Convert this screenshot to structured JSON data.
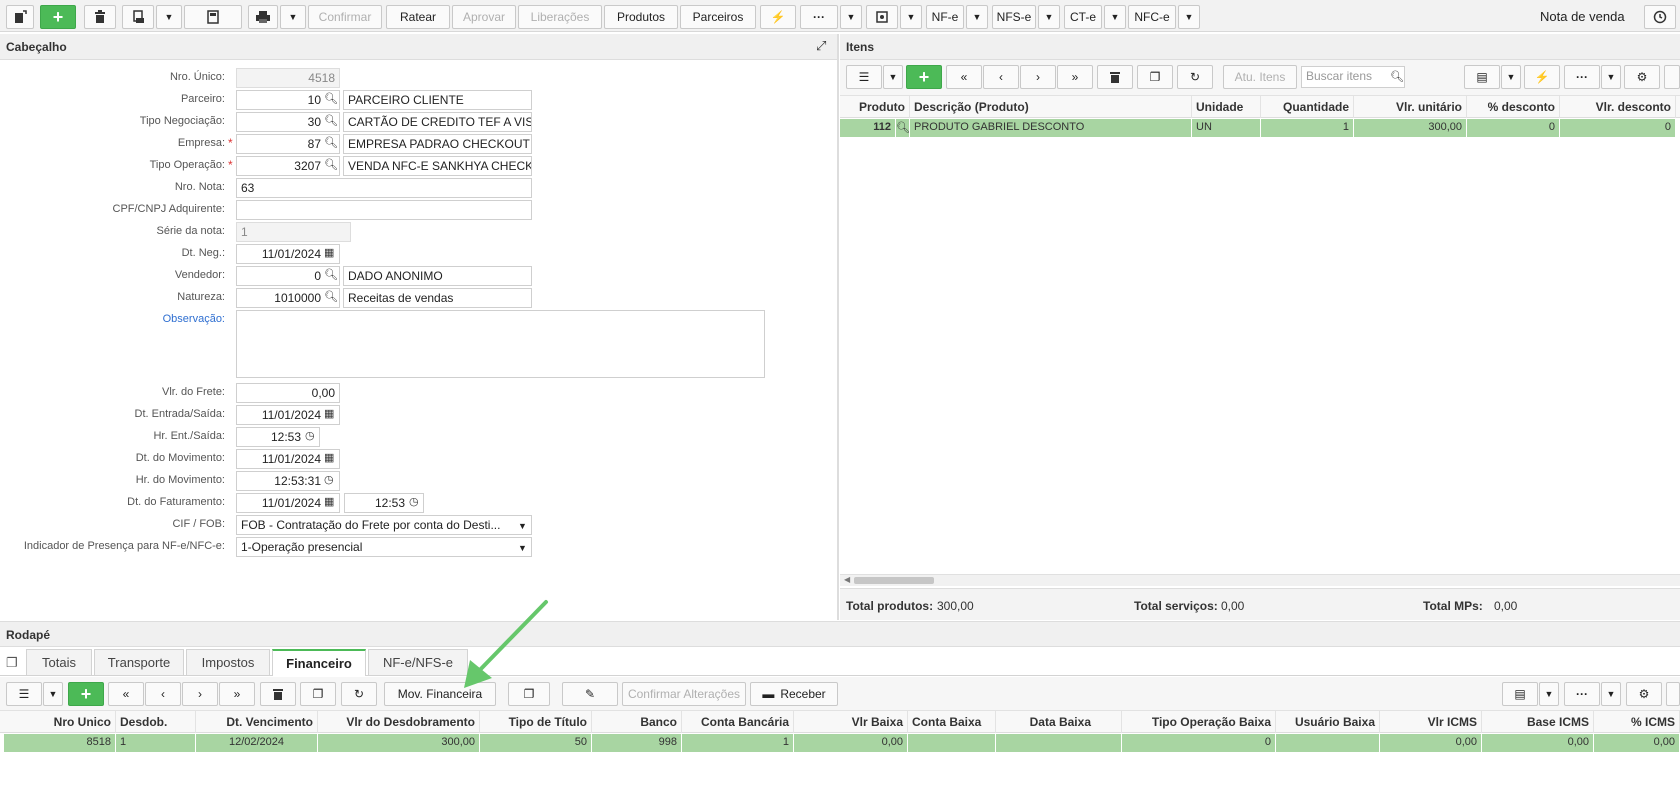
{
  "toolbar": {
    "confirmar": "Confirmar",
    "ratear": "Ratear",
    "aprovar": "Aprovar",
    "liberacoes": "Liberações",
    "produtos": "Produtos",
    "parceiros": "Parceiros",
    "more": "···",
    "nfe": "NF-e",
    "nfse": "NFS-e",
    "cte": "CT-e",
    "nfce": "NFC-e",
    "title": "Nota de venda"
  },
  "header": {
    "title": "Cabeçalho",
    "fields": {
      "nro_unico_label": "Nro. Único:",
      "nro_unico": "4518",
      "parceiro_label": "Parceiro:",
      "parceiro_code": "10",
      "parceiro_name": "PARCEIRO CLIENTE",
      "tipo_neg_label": "Tipo Negociação:",
      "tipo_neg_code": "30",
      "tipo_neg_name": "CARTÃO DE CREDITO TEF A VIS",
      "empresa_label": "Empresa:",
      "empresa_code": "87",
      "empresa_name": "EMPRESA PADRAO CHECKOUT",
      "tipo_op_label": "Tipo Operação:",
      "tipo_op_code": "3207",
      "tipo_op_name": "VENDA NFC-E SANKHYA CHECK",
      "nro_nota_label": "Nro. Nota:",
      "nro_nota": "63",
      "cpf_label": "CPF/CNPJ Adquirente:",
      "cpf": "",
      "serie_label": "Série da nota:",
      "serie": "1",
      "dt_neg_label": "Dt. Neg.:",
      "dt_neg": "11/01/2024",
      "vendedor_label": "Vendedor:",
      "vendedor_code": "0",
      "vendedor_name": "DADO ANONIMO",
      "natureza_label": "Natureza:",
      "natureza_code": "1010000",
      "natureza_name": "Receitas de vendas",
      "observacao_label": "Observação:",
      "frete_label": "Vlr. do Frete:",
      "frete": "0,00",
      "dt_entrada_label": "Dt. Entrada/Saída:",
      "dt_entrada": "11/01/2024",
      "hr_ent_label": "Hr. Ent./Saída:",
      "hr_ent": "12:53",
      "dt_mov_label": "Dt. do Movimento:",
      "dt_mov": "11/01/2024",
      "hr_mov_label": "Hr. do Movimento:",
      "hr_mov": "12:53:31",
      "dt_fat_label": "Dt. do Faturamento:",
      "dt_fat": "11/01/2024",
      "hr_fat": "12:53",
      "cif_label": "CIF / FOB:",
      "cif": "FOB - Contratação do Frete por conta do Desti...",
      "presenca_label": "Indicador de Presença para NF-e/NFC-e:",
      "presenca": "1-Operação presencial"
    }
  },
  "itens": {
    "title": "Itens",
    "atu_itens": "Atu. Itens",
    "search_placeholder": "Buscar itens",
    "columns": [
      "Produto",
      "Descrição (Produto)",
      "Unidade",
      "Quantidade",
      "Vlr. unitário",
      "% desconto",
      "Vlr. desconto"
    ],
    "row": {
      "produto": "112",
      "descricao": "PRODUTO GABRIEL DESCONTO",
      "unidade": "UN",
      "quantidade": "1",
      "vlr_unitario": "300,00",
      "pct_desconto": "0",
      "vlr_desconto": "0"
    },
    "totals": {
      "produtos_label": "Total produtos:",
      "produtos": "300,00",
      "servicos_label": "Total serviços:",
      "servicos": "0,00",
      "mps_label": "Total MPs:",
      "mps": "0,00"
    }
  },
  "rodape": {
    "title": "Rodapé",
    "tabs": [
      "Totais",
      "Transporte",
      "Impostos",
      "Financeiro",
      "NF-e/NFS-e"
    ],
    "mov_financeira": "Mov. Financeira",
    "confirmar_alteracoes": "Confirmar Alterações",
    "receber": "Receber",
    "columns": [
      "Nro Unico",
      "Desdob.",
      "Dt. Vencimento",
      "Vlr do Desdobramento",
      "Tipo de Título",
      "Banco",
      "Conta Bancária",
      "Vlr Baixa",
      "Conta Baixa",
      "Data Baixa",
      "Tipo Operação Baixa",
      "Usuário Baixa",
      "Vlr ICMS",
      "Base ICMS",
      "% ICMS"
    ],
    "row": [
      "8518",
      "1",
      "12/02/2024",
      "300,00",
      "50",
      "998",
      "1",
      "0,00",
      "",
      "",
      "0",
      "",
      "0,00",
      "0,00",
      "0,00"
    ]
  },
  "colors": {
    "accent": "#4cba57",
    "row_selected": "#a8d5a2",
    "arrow": "#66c76b"
  }
}
